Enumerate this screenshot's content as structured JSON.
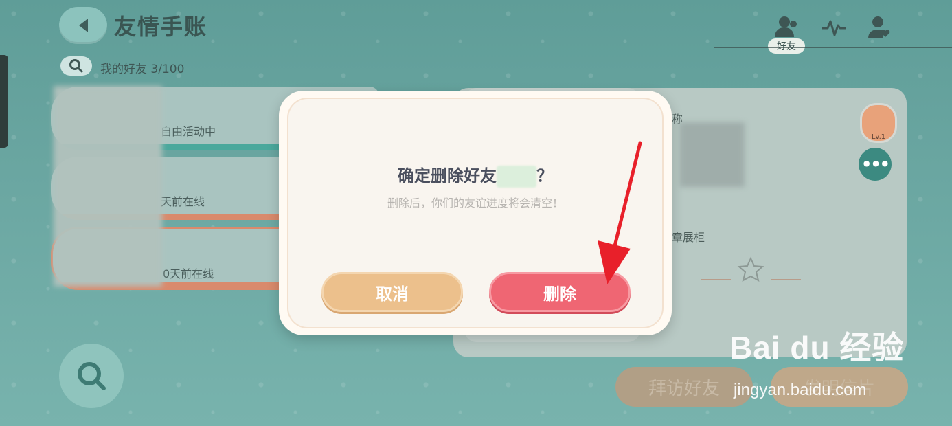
{
  "header": {
    "title": "友情手账",
    "active_tab_label": "好友",
    "friend_count_label": "我的好友 3/100"
  },
  "friends": [
    {
      "status": "自由活动中",
      "accent": "#4aa89c"
    },
    {
      "status": "天前在线",
      "accent": "#e0785a"
    },
    {
      "status": "0天前在线",
      "accent": "#e0785a"
    }
  ],
  "profile_panel": {
    "nickname_label": "称",
    "showcase_label": "章展柜",
    "level_label": "Lv.1",
    "more_label": "•••"
  },
  "bottom": {
    "visit_label": "拜访好友",
    "card_label": "发明信片"
  },
  "dialog": {
    "title_prefix": "确定删除好友",
    "title_suffix": "？",
    "subtitle": "删除后，你们的友谊进度将会清空！",
    "cancel_label": "取消",
    "delete_label": "删除"
  },
  "watermark": {
    "logo": "Bai du 经验",
    "url": "jingyan.baidu.com"
  },
  "colors": {
    "delete": "#ef6673",
    "cancel": "#ecc08c",
    "arrow": "#e8202a",
    "background": "#6aa6a1"
  }
}
